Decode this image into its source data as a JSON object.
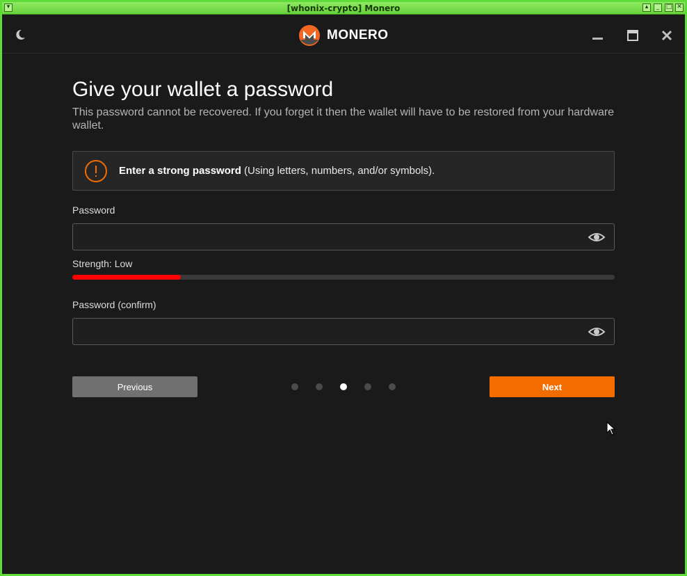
{
  "window": {
    "title": "[whonix-crypto] Monero"
  },
  "header": {
    "brand": "MONERO"
  },
  "page": {
    "title": "Give your wallet a password",
    "subtitle": "This password cannot be recovered. If you forget it then the wallet will have to be restored from your hardware wallet.",
    "notice_bold": "Enter a strong password",
    "notice_rest": " (Using letters, numbers, and/or symbols)."
  },
  "password": {
    "label": "Password",
    "value": "",
    "placeholder": ""
  },
  "strength": {
    "label": "Strength: Low",
    "fraction": 0.2
  },
  "confirm": {
    "label": "Password (confirm)",
    "value": "",
    "placeholder": ""
  },
  "nav": {
    "previous_label": "Previous",
    "next_label": "Next",
    "step_count": 5,
    "current_step": 3
  },
  "colors": {
    "accent": "#f26c00",
    "strength_low": "#ff0000",
    "frame": "#5fdc3a",
    "background": "#1a1a1a"
  },
  "icons": {
    "theme": "moon-icon",
    "logo": "monero-logo-icon",
    "notice": "exclamation-circle-icon",
    "reveal": "eye-icon"
  }
}
